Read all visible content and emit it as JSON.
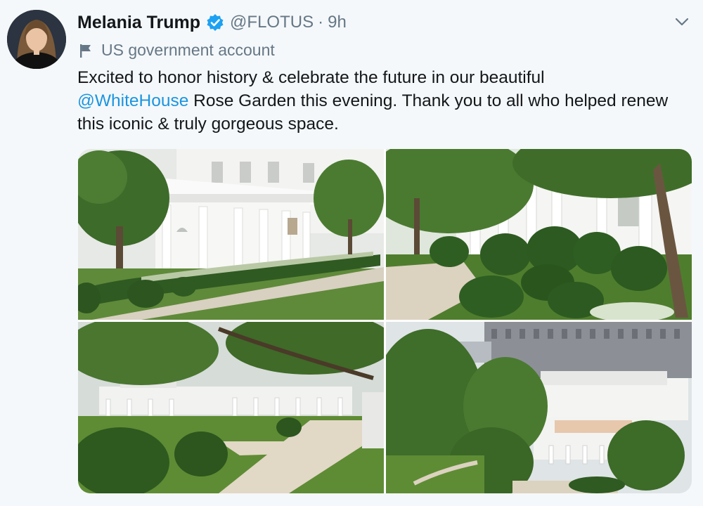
{
  "tweet": {
    "display_name": "Melania Trump",
    "handle": "@FLOTUS",
    "separator": "·",
    "time": "9h",
    "label": "US government account",
    "text_part1": "Excited to honor history & celebrate the future in our beautiful",
    "mention": "@WhiteHouse",
    "text_part2": " Rose Garden this evening. Thank you to all who helped renew this iconic & truly gorgeous space."
  },
  "icons": {
    "verified": "verified-badge-icon",
    "label": "flag-icon",
    "menu": "chevron-down-icon"
  },
  "colors": {
    "background": "#f5f8fa",
    "text": "#14171a",
    "muted": "#657786",
    "link": "#1b95e0",
    "verified": "#1da1f2"
  }
}
